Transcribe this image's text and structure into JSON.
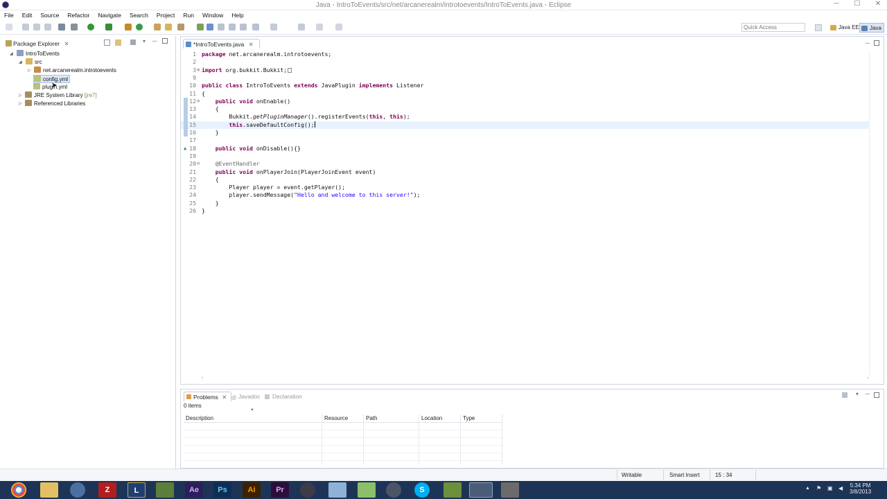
{
  "window": {
    "title": "Java - IntroToEvents/src/net/arcanerealm/introtoevents/IntroToEvents.java - Eclipse"
  },
  "menu": [
    "File",
    "Edit",
    "Source",
    "Refactor",
    "Navigate",
    "Search",
    "Project",
    "Run",
    "Window",
    "Help"
  ],
  "toolbar": {
    "quick_access_placeholder": "Quick Access",
    "perspectives": [
      "Java EE",
      "Java"
    ]
  },
  "package_explorer": {
    "tab_label": "Package Explorer",
    "tree": {
      "project": "IntroToEvents",
      "src": "src",
      "package": "net.arcanerealm.introtoevents",
      "config": "config.yml",
      "plugin": "plugin.yml",
      "jre": "JRE System Library",
      "jre_suffix": "[jre7]",
      "libs": "Referenced Libraries"
    }
  },
  "editor": {
    "tab_label": "*IntroToEvents.java",
    "scroll_glyphs": {
      "left": "‹",
      "right": "›"
    },
    "lines": [
      {
        "n": "1"
      },
      {
        "n": "2"
      },
      {
        "n": "3"
      },
      {
        "n": "9"
      },
      {
        "n": "10"
      },
      {
        "n": "11"
      },
      {
        "n": "12"
      },
      {
        "n": "13"
      },
      {
        "n": "14"
      },
      {
        "n": "15"
      },
      {
        "n": "16"
      },
      {
        "n": "17"
      },
      {
        "n": "18"
      },
      {
        "n": "19"
      },
      {
        "n": "20"
      },
      {
        "n": "21"
      },
      {
        "n": "22"
      },
      {
        "n": "23"
      },
      {
        "n": "24"
      },
      {
        "n": "25"
      },
      {
        "n": "26"
      }
    ],
    "code": {
      "l1": {
        "kw": "package",
        "rest": " net.arcanerealm.introtoevents;"
      },
      "l3": {
        "kw": "import",
        "rest": " org.bukkit.Bukkit;"
      },
      "l10": {
        "kw1": "public class",
        "mid1": " IntroToEvents ",
        "kw2": "extends",
        "mid2": " JavaPlugin ",
        "kw3": "implements",
        "rest": " Listener"
      },
      "l11": "{",
      "l12": {
        "kw": "    public void",
        "rest": " onEnable()"
      },
      "l13": "    {",
      "l14": {
        "a": "        Bukkit.",
        "i": "getPluginManager",
        "b": "().registerEvents(",
        "kw1": "this",
        "c": ", ",
        "kw2": "this",
        "d": ");"
      },
      "l15": {
        "kw": "        this",
        "rest": ".saveDefaultConfig();"
      },
      "l16": "    }",
      "l17": "",
      "l18": {
        "kw": "    public void",
        "rest": " onDisable(){}"
      },
      "l19": "",
      "l20": "    @EventHandler",
      "l21": {
        "kw": "    public void",
        "rest": " onPlayerJoin(PlayerJoinEvent event)"
      },
      "l22": "    {",
      "l23": "        Player player = event.getPlayer();",
      "l24": {
        "a": "        player.sendMessage(",
        "s": "\"Hello and welcome to this server!\"",
        "b": ");"
      },
      "l25": "    }",
      "l26": "}"
    }
  },
  "problems": {
    "tabs": [
      "Problems",
      "Javadoc",
      "Declaration"
    ],
    "count": "0 items",
    "columns": [
      "Description",
      "Resource",
      "Path",
      "Location",
      "Type"
    ]
  },
  "status": {
    "writable": "Writable",
    "insert": "Smart Insert",
    "position": "15 : 34"
  },
  "taskbar": {
    "time": "5:34 PM",
    "date": "3/8/2013"
  }
}
